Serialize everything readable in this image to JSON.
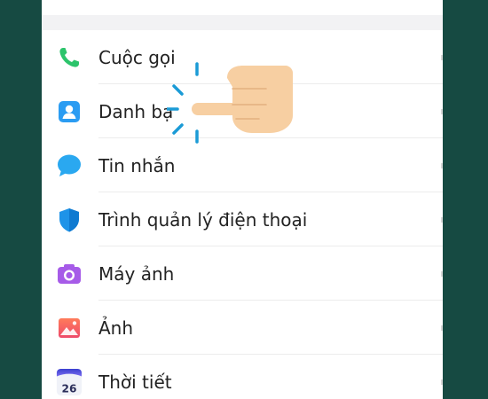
{
  "settings_list": {
    "items": [
      {
        "label": "Cuộc gọi",
        "icon": "phone-icon",
        "color": "#2cc46b"
      },
      {
        "label": "Danh bạ",
        "icon": "contacts-icon",
        "color": "#2b9cf2"
      },
      {
        "label": "Tin nhắn",
        "icon": "message-icon",
        "color": "#2aa8f0"
      },
      {
        "label": "Trình quản lý điện thoại",
        "icon": "shield-icon",
        "color": "#1e93e8"
      },
      {
        "label": "Máy ảnh",
        "icon": "camera-icon",
        "color": "#a65be8"
      },
      {
        "label": "Ảnh",
        "icon": "gallery-icon",
        "color": "#f25a58"
      },
      {
        "label": "Thời tiết",
        "icon": "weather-icon",
        "color": "#5b5fe0",
        "icon_text": "26"
      }
    ]
  },
  "overlay": {
    "icon": "pointing-hand-icon",
    "skin_color": "#f7cfa2",
    "burst_color": "#1b9bd6"
  }
}
